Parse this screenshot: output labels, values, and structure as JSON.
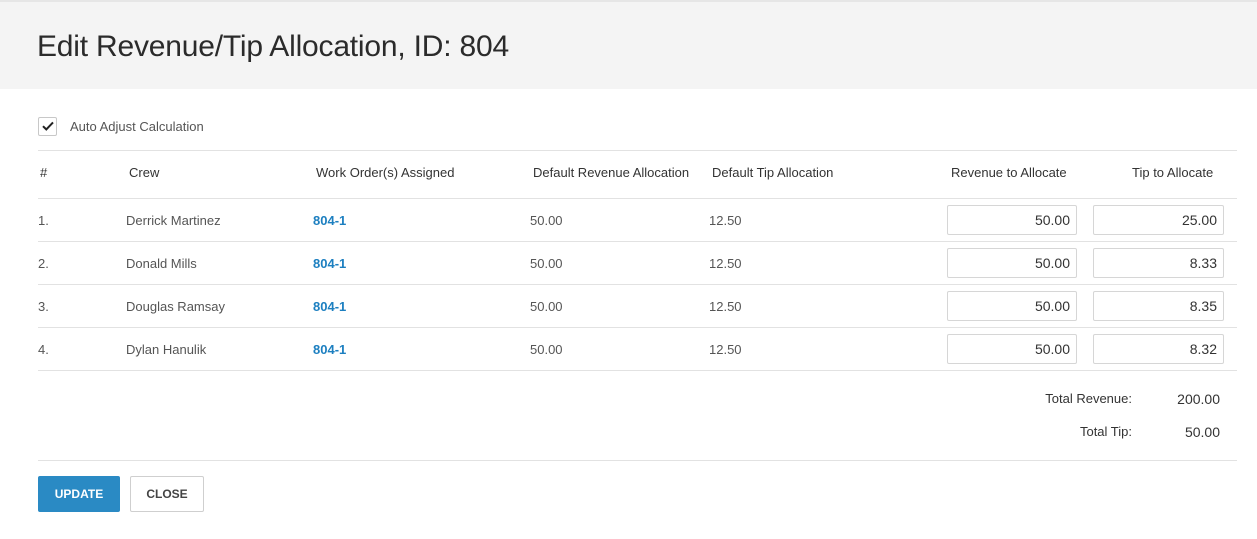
{
  "modal": {
    "title": "Edit Revenue/Tip Allocation, ID: 804"
  },
  "auto_adjust": {
    "label": "Auto Adjust Calculation",
    "checked": true
  },
  "table": {
    "headers": {
      "num": "#",
      "crew": "Crew",
      "work_orders": "Work Order(s) Assigned",
      "default_revenue": "Default Revenue Allocation",
      "default_tip": "Default Tip Allocation",
      "revenue_to_allocate": "Revenue to Allocate",
      "tip_to_allocate": "Tip to Allocate"
    },
    "rows": [
      {
        "num": "1.",
        "crew": "Derrick Martinez",
        "work_order": "804-1",
        "default_revenue": "50.00",
        "default_tip": "12.50",
        "revenue": "50.00",
        "tip": "25.00"
      },
      {
        "num": "2.",
        "crew": "Donald Mills",
        "work_order": "804-1",
        "default_revenue": "50.00",
        "default_tip": "12.50",
        "revenue": "50.00",
        "tip": "8.33"
      },
      {
        "num": "3.",
        "crew": "Douglas Ramsay",
        "work_order": "804-1",
        "default_revenue": "50.00",
        "default_tip": "12.50",
        "revenue": "50.00",
        "tip": "8.35"
      },
      {
        "num": "4.",
        "crew": "Dylan Hanulik",
        "work_order": "804-1",
        "default_revenue": "50.00",
        "default_tip": "12.50",
        "revenue": "50.00",
        "tip": "8.32"
      }
    ]
  },
  "totals": {
    "revenue_label": "Total Revenue:",
    "revenue_value": "200.00",
    "tip_label": "Total Tip:",
    "tip_value": "50.00"
  },
  "buttons": {
    "update": "UPDATE",
    "close": "CLOSE"
  },
  "colors": {
    "accent": "#2a8ac4",
    "link": "#1c7fc0",
    "header_bg": "#f4f4f4"
  }
}
